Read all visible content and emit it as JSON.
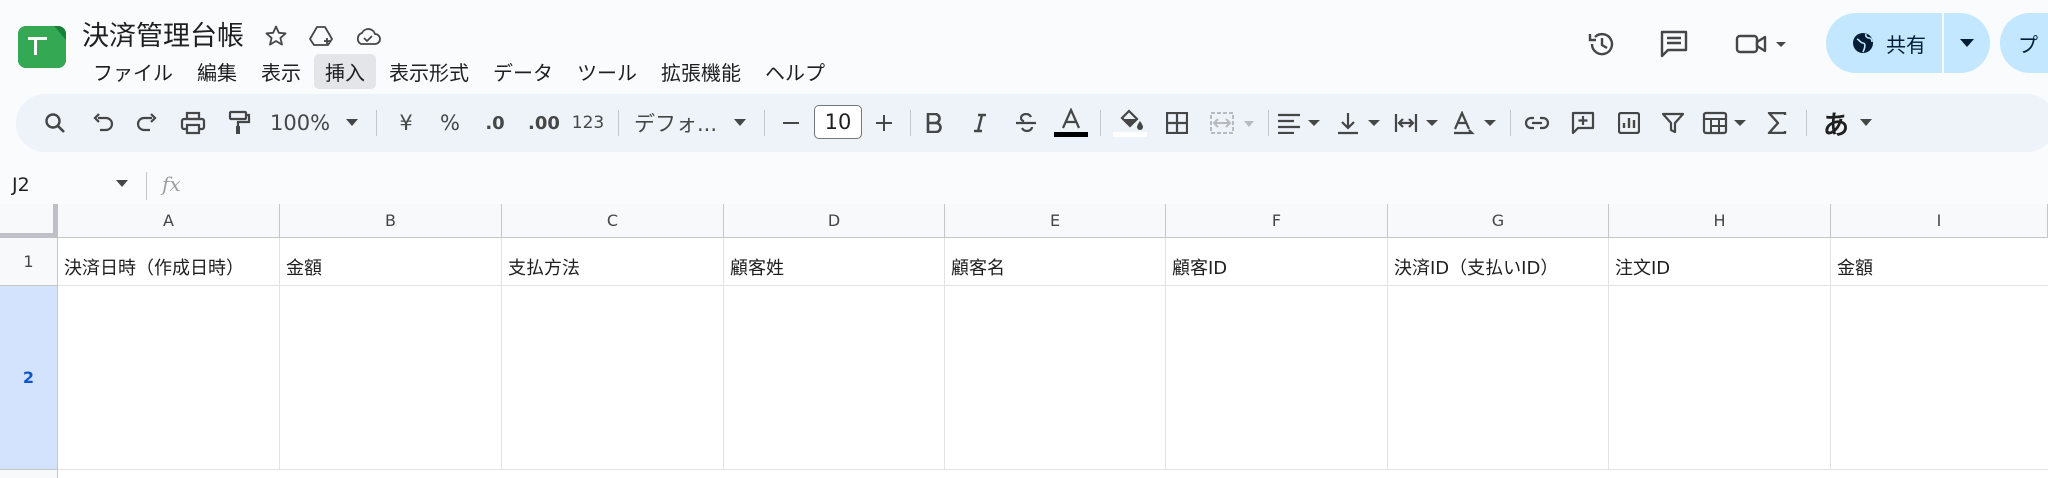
{
  "app": {
    "doc_title": "決済管理台帳",
    "menu": [
      "ファイル",
      "編集",
      "表示",
      "挿入",
      "表示形式",
      "データ",
      "ツール",
      "拡張機能",
      "ヘルプ"
    ],
    "active_menu": "挿入",
    "share_label": "共有",
    "publish_label": "プ"
  },
  "toolbar": {
    "zoom": "100%",
    "currency": "¥",
    "percent": "%",
    "dec_decrease": ".0",
    "dec_increase": ".00",
    "number_format": "123",
    "font": "デフォ...",
    "font_size": "10",
    "input_tools": "あ"
  },
  "formula_bar": {
    "cell_ref": "J2",
    "fx": "fx",
    "value": ""
  },
  "sheet": {
    "columns": [
      "A",
      "B",
      "C",
      "D",
      "E",
      "F",
      "G",
      "H",
      "I"
    ],
    "rows": [
      "1",
      "2"
    ],
    "header_row": [
      "決済日時（作成日時）",
      "金額",
      "支払方法",
      "顧客姓",
      "顧客名",
      "顧客ID",
      "決済ID（支払いID）",
      "注文ID",
      "金額"
    ]
  },
  "colors": {
    "accent": "#0b57d0",
    "share_bg": "#c2e7ff",
    "toolbar_bg": "#eef2f9",
    "selected_row": "#d3e3fd"
  }
}
